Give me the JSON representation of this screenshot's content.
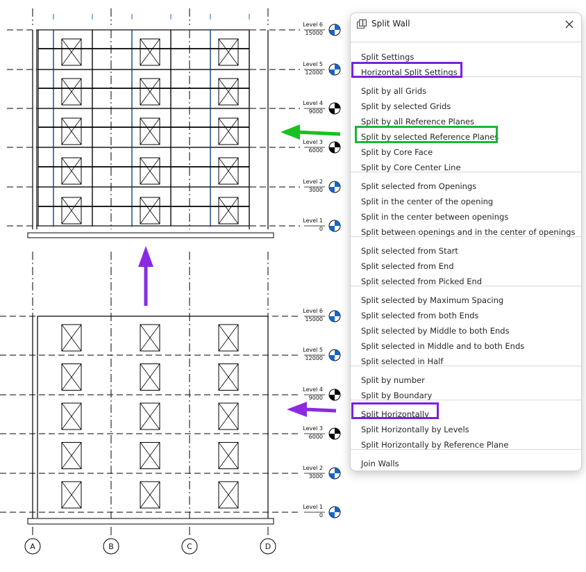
{
  "levels": [
    {
      "name": "Level 6",
      "elevation": "15000"
    },
    {
      "name": "Level 5",
      "elevation": "12000"
    },
    {
      "name": "Level 4",
      "elevation": "9000"
    },
    {
      "name": "Level 3",
      "elevation": "6000"
    },
    {
      "name": "Level 2",
      "elevation": "3000"
    },
    {
      "name": "Level 1",
      "elevation": "0"
    }
  ],
  "grids": [
    "A",
    "B",
    "C",
    "D"
  ],
  "dialog": {
    "title": "Split Wall",
    "menu_items": [
      "Split Settings",
      "Horizontal Split Settings",
      "Split by all Grids",
      "Split by selected Grids",
      "Split by all Reference Planes",
      "Split by selected Reference Planes",
      "Split by Core Face",
      "Split by Core Center Line",
      "Split selected from Openings",
      "Split in the center of the opening",
      "Split in the center between openings",
      "Split between openings and in the center of openings",
      "Split selected from Start",
      "Split selected from End",
      "Split selected from Picked End",
      "Split selected by Maximum Spacing",
      "Split selected from both Ends",
      "Split selected by Middle to both Ends",
      "Split selected in Middle and to both Ends",
      "Split selected in Half",
      "Split by number",
      "Split by Boundary",
      "Split Horizontally",
      "Split Horizontally by Levels",
      "Split Horizontally by Reference Plane",
      "Join Walls"
    ]
  },
  "colors": {
    "highlight_purple": "#7c1fe0",
    "highlight_green": "#1db33a",
    "arrow_green": "#19c021",
    "arrow_purple": "#8a2be2",
    "level_marker_blue": "#1466c8"
  },
  "icons": {
    "app": "split-wall-app-icon",
    "close": "close-icon"
  }
}
